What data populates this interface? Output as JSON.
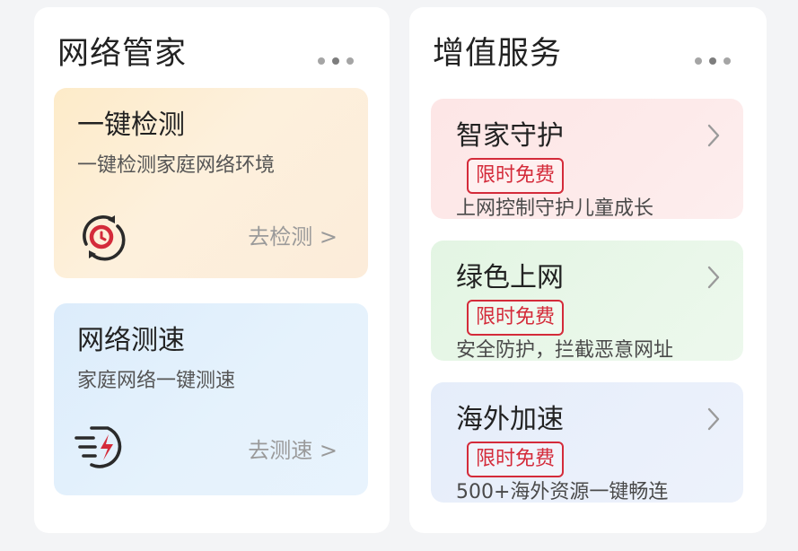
{
  "network_manager": {
    "title": "网络管家",
    "more_icon": "more-dots-icon",
    "one_key_check": {
      "title": "一键检测",
      "subtitle": "一键检测家庭网络环境",
      "link": "去检测 >",
      "icon": "detect-cycle-icon"
    },
    "speed_test": {
      "title": "网络测速",
      "subtitle": "家庭网络一键测速",
      "link": "去测速 >",
      "icon": "speed-lightning-icon"
    }
  },
  "value_added": {
    "title": "增值服务",
    "more_icon": "more-dots-icon",
    "services": [
      {
        "title": "智家守护",
        "badge": "限时免费",
        "desc": "上网控制守护儿童成长",
        "icon": "chevron-right-icon"
      },
      {
        "title": "绿色上网",
        "badge": "限时免费",
        "desc": "安全防护，拦截恶意网址",
        "icon": "chevron-right-icon"
      },
      {
        "title": "海外加速",
        "badge": "限时免费",
        "desc": "500+海外资源一键畅连",
        "icon": "chevron-right-icon"
      }
    ]
  },
  "colors": {
    "accent_red": "#d42b3a",
    "check_card_bg": "#fdebc9",
    "speed_card_bg": "#dcecfb",
    "service1_bg": "#fde6e6",
    "service2_bg": "#e3f5e3",
    "service3_bg": "#e5edfa"
  }
}
